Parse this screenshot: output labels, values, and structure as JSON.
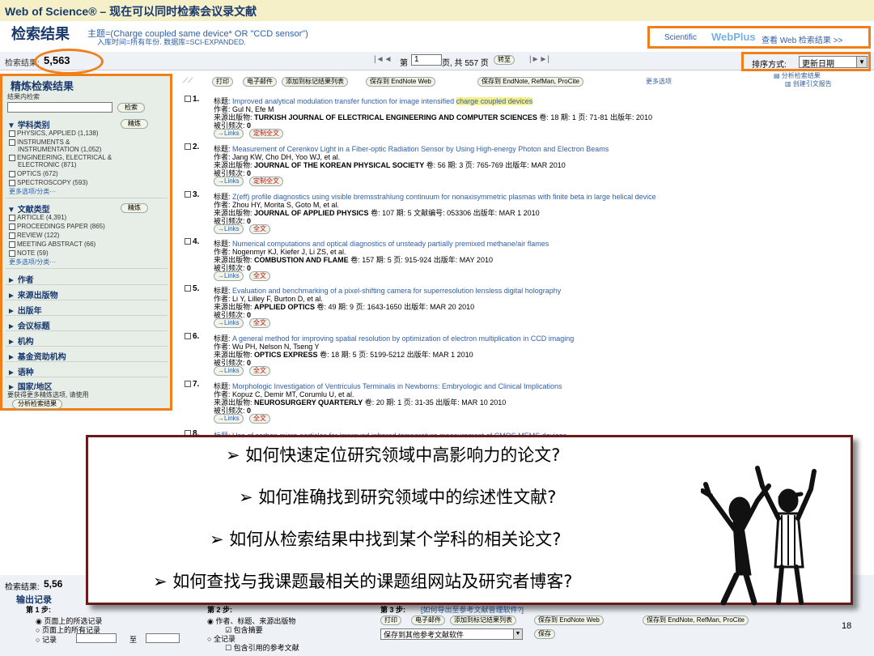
{
  "app": {
    "title": "Web of Science® – 现在可以同时检索会议录文献"
  },
  "header": {
    "results_label": "检索结果",
    "topic": "主题=(Charge coupled same device* OR \"CCD sensor\")",
    "subline": "入库时间=所有年份. 数据库=SCI-EXPANDED."
  },
  "webplus": {
    "brand": "Scientific",
    "logo": "WebPlus",
    "link": "查看 Web 检索结果 >>"
  },
  "countbar": {
    "label": "检索结果:",
    "count": "5,563",
    "page_prefix": "第",
    "page_value": "1",
    "page_suffix": "页, 共 557 页",
    "goto": "转至",
    "sort_label": "排序方式:",
    "sort_value": "更新日期"
  },
  "actions": {
    "print": "打印",
    "email": "电子邮件",
    "add_marked": "添加到标记结果列表",
    "save_endnote_web": "保存到 EndNote Web",
    "save_endnote": "保存到 EndNote, RefMan, ProCite",
    "more": "更多选项",
    "analyze": "分析检索结果",
    "citation_report": "创建引文报告"
  },
  "refine": {
    "title": "精炼检索结果",
    "within_label": "结果内检索",
    "search_btn": "检索",
    "refine_btn": "精炼",
    "more_options": "更多选项/分类···",
    "subject": {
      "label": "学科类别",
      "items": [
        "PHYSICS, APPLIED (1,138)",
        "INSTRUMENTS &",
        "INSTRUMENTATION (1,052)",
        "ENGINEERING, ELECTRICAL &",
        "ELECTRONIC (871)",
        "OPTICS (672)",
        "SPECTROSCOPY (593)"
      ]
    },
    "doctype": {
      "label": "文献类型",
      "items": [
        "ARTICLE (4,391)",
        "PROCEEDINGS PAPER (865)",
        "REVIEW (122)",
        "MEETING ABSTRACT (66)",
        "NOTE (59)"
      ]
    },
    "facets": [
      "作者",
      "来源出版物",
      "出版年",
      "会议标题",
      "机构",
      "基金资助机构",
      "语种",
      "国家/地区"
    ],
    "footnote": "要获得更多精炼选项, 请使用",
    "analyze_btn": "分析检索结果"
  },
  "records": [
    {
      "num": "1.",
      "title_prefix": "标题: ",
      "title": "Improved analytical modulation transfer function for image intensified ",
      "title_hl": "charge coupled devices",
      "authors": "作者: Gul N, Efe M",
      "source_prefix": "来源出版物: ",
      "source": "TURKISH JOURNAL OF ELECTRICAL ENGINEERING AND COMPUTER SCIENCES",
      "source_tail": "卷: 18  期: 1  页: 71-81  出版年: 2010",
      "cited_prefix": "被引频次: ",
      "cited": "0",
      "links": "→Links",
      "fulltext": "定制全文"
    },
    {
      "num": "2.",
      "title_prefix": "标题: ",
      "title": "Measurement of Cerenkov Light in a Fiber-optic Radiation Sensor by Using High-energy Photon and Electron Beams",
      "title_hl": "",
      "authors": "作者: Jang KW, Cho DH, Yoo WJ, et al.",
      "source_prefix": "来源出版物: ",
      "source": "JOURNAL OF THE KOREAN PHYSICAL SOCIETY",
      "source_tail": "卷: 56  期: 3  页: 765-769  出版年: MAR 2010",
      "cited_prefix": "被引频次: ",
      "cited": "0",
      "links": "→Links",
      "fulltext": "定制全文"
    },
    {
      "num": "3.",
      "title_prefix": "标题: ",
      "title": "Z(eff) profile diagnostics using visible bremsstrahlung continuum for nonaxisymmetric plasmas with finite beta in large helical device",
      "title_hl": "",
      "authors": "作者: Zhou HY, Morita S, Goto M, et al.",
      "source_prefix": "来源出版物: ",
      "source": "JOURNAL OF APPLIED PHYSICS",
      "source_tail": "卷: 107  期: 5  文献编号: 053306  出版年: MAR 1 2010",
      "cited_prefix": "被引频次: ",
      "cited": "0",
      "links": "→Links",
      "fulltext": "全文"
    },
    {
      "num": "4.",
      "title_prefix": "标题: ",
      "title": "Numerical computations and optical diagnostics of unsteady partially premixed methane/air flames",
      "title_hl": "",
      "authors": "作者: Nogenmyr KJ, Kiefer J, Li ZS, et al.",
      "source_prefix": "来源出版物: ",
      "source": "COMBUSTION AND FLAME",
      "source_tail": "卷: 157  期: 5  页: 915-924  出版年: MAY 2010",
      "cited_prefix": "被引频次: ",
      "cited": "0",
      "links": "→Links",
      "fulltext": "全文"
    },
    {
      "num": "5.",
      "title_prefix": "标题: ",
      "title": "Evaluation and benchmarking of a pixel-shifting camera for superresolution lensless digital holography",
      "title_hl": "",
      "authors": "作者: Li Y, Lilley F, Burton D, et al.",
      "source_prefix": "来源出版物: ",
      "source": "APPLIED OPTICS",
      "source_tail": "卷: 49  期: 9  页: 1643-1650  出版年: MAR 20 2010",
      "cited_prefix": "被引频次: ",
      "cited": "0",
      "links": "→Links",
      "fulltext": "全文"
    },
    {
      "num": "6.",
      "title_prefix": "标题: ",
      "title": "A general method for improving spatial resolution by optimization of electron multiplication in CCD imaging",
      "title_hl": "",
      "authors": "作者: Wu PH, Nelson N, Tseng Y",
      "source_prefix": "来源出版物: ",
      "source": "OPTICS EXPRESS",
      "source_tail": "卷: 18  期: 5  页: 5199-5212  出版年: MAR 1 2010",
      "cited_prefix": "被引频次: ",
      "cited": "0",
      "links": "→Links",
      "fulltext": "全文"
    },
    {
      "num": "7.",
      "title_prefix": "标题: ",
      "title": "Morphologic Investigation of Ventriculus Terminalis in Newborns: Embryologic and Clinical Implications",
      "title_hl": "",
      "authors": "作者: Kopuz C, Demir MT, Corumlu U, et al.",
      "source_prefix": "来源出版物: ",
      "source": "NEUROSURGERY QUARTERLY",
      "source_tail": "卷: 20  期: 1  页: 31-35  出版年: MAR 10 2010",
      "cited_prefix": "被引频次: ",
      "cited": "0",
      "links": "→Links",
      "fulltext": "全文"
    }
  ],
  "record8": {
    "num": "8.",
    "title": "标题: Use of carbon micro-particles for improved infrared temperature measurement of CMOS MEMS devices"
  },
  "overlay": {
    "q1": "➢ 如何快速定位研究领域中高影响力的论文?",
    "q2": "➢ 如何准确找到研究领域中的综述性文献?",
    "q3": "➢ 如何从检索结果中找到某个学科的相关论文?",
    "q4": "➢ 如何查找与我课题最相关的课题组网站及研究者博客?"
  },
  "bottom": {
    "count_label": "检索结果:",
    "count": "5,56",
    "output_title": "输出记录",
    "step1": "第 1 步:",
    "step2": "第 2 步:",
    "step3": "第 3 步:",
    "step3_desc": "[如何导出至参考文献管理软件?]",
    "opt_page_selected": "页面上的所选记录",
    "opt_page_all": "页面上的所有记录",
    "opt_records": "记录",
    "opt_to": "至",
    "opt_author_title": "作者、标题、来源出版物",
    "opt_abstract": "包含摘要",
    "opt_full": "全记录",
    "opt_cited": "包含引用的参考文献",
    "save_other": "保存到其他参考文献软件",
    "save_btn": "保存",
    "slide_number": "18"
  },
  "colors": {
    "accent": "#f07f1a",
    "link": "#2f5fa8",
    "navy": "#1b3a6b",
    "highlight": "#f7ef8a"
  }
}
